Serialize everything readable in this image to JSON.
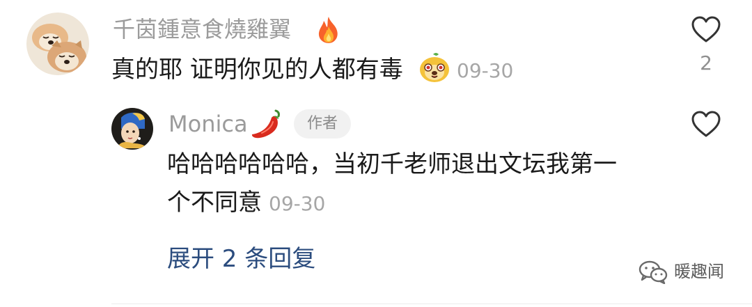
{
  "comment": {
    "username": "千茵鍾意食燒雞翼",
    "username_emoji_icon": "fire-icon",
    "text": "真的耶 证明你见的人都有毒",
    "text_emoji_icon": "smiling-mascot-emoji-icon",
    "timestamp": "09-30",
    "like_count": "2"
  },
  "reply": {
    "username": "Monica",
    "username_emoji_icon": "chili-pepper-icon",
    "author_badge": "作者",
    "text_line1": "哈哈哈哈哈哈，当初千老师退出文坛我第一",
    "text_line2": "个不同意",
    "timestamp": "09-30"
  },
  "expand_replies_label": "展开 2 条回复",
  "watermark": {
    "text": "暖趣闻",
    "icon": "wechat-icon"
  },
  "colors": {
    "username": "#9b9b9b",
    "text": "#1a1a1a",
    "timestamp": "#a6a6a6",
    "expand_link": "#2b4c7e",
    "badge_bg": "#f1f1f1"
  }
}
